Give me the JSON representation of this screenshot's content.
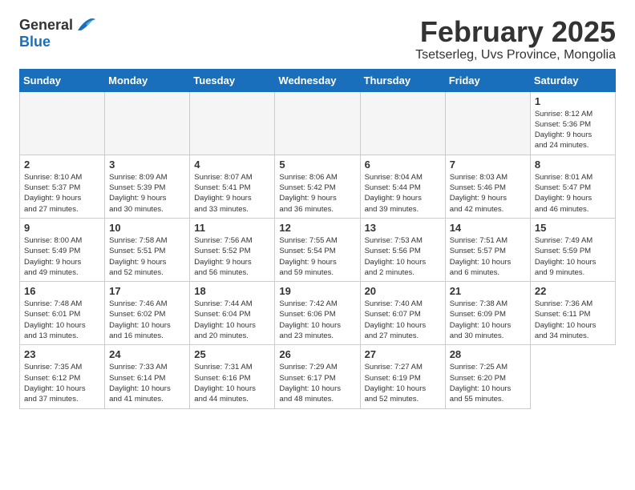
{
  "header": {
    "logo_general": "General",
    "logo_blue": "Blue",
    "month_title": "February 2025",
    "location": "Tsetserleg, Uvs Province, Mongolia"
  },
  "weekdays": [
    "Sunday",
    "Monday",
    "Tuesday",
    "Wednesday",
    "Thursday",
    "Friday",
    "Saturday"
  ],
  "days": [
    {
      "date": "",
      "info": ""
    },
    {
      "date": "",
      "info": ""
    },
    {
      "date": "",
      "info": ""
    },
    {
      "date": "",
      "info": ""
    },
    {
      "date": "",
      "info": ""
    },
    {
      "date": "",
      "info": ""
    },
    {
      "date": "1",
      "info": "Sunrise: 8:12 AM\nSunset: 5:36 PM\nDaylight: 9 hours\nand 24 minutes."
    },
    {
      "date": "2",
      "info": "Sunrise: 8:10 AM\nSunset: 5:37 PM\nDaylight: 9 hours\nand 27 minutes."
    },
    {
      "date": "3",
      "info": "Sunrise: 8:09 AM\nSunset: 5:39 PM\nDaylight: 9 hours\nand 30 minutes."
    },
    {
      "date": "4",
      "info": "Sunrise: 8:07 AM\nSunset: 5:41 PM\nDaylight: 9 hours\nand 33 minutes."
    },
    {
      "date": "5",
      "info": "Sunrise: 8:06 AM\nSunset: 5:42 PM\nDaylight: 9 hours\nand 36 minutes."
    },
    {
      "date": "6",
      "info": "Sunrise: 8:04 AM\nSunset: 5:44 PM\nDaylight: 9 hours\nand 39 minutes."
    },
    {
      "date": "7",
      "info": "Sunrise: 8:03 AM\nSunset: 5:46 PM\nDaylight: 9 hours\nand 42 minutes."
    },
    {
      "date": "8",
      "info": "Sunrise: 8:01 AM\nSunset: 5:47 PM\nDaylight: 9 hours\nand 46 minutes."
    },
    {
      "date": "9",
      "info": "Sunrise: 8:00 AM\nSunset: 5:49 PM\nDaylight: 9 hours\nand 49 minutes."
    },
    {
      "date": "10",
      "info": "Sunrise: 7:58 AM\nSunset: 5:51 PM\nDaylight: 9 hours\nand 52 minutes."
    },
    {
      "date": "11",
      "info": "Sunrise: 7:56 AM\nSunset: 5:52 PM\nDaylight: 9 hours\nand 56 minutes."
    },
    {
      "date": "12",
      "info": "Sunrise: 7:55 AM\nSunset: 5:54 PM\nDaylight: 9 hours\nand 59 minutes."
    },
    {
      "date": "13",
      "info": "Sunrise: 7:53 AM\nSunset: 5:56 PM\nDaylight: 10 hours\nand 2 minutes."
    },
    {
      "date": "14",
      "info": "Sunrise: 7:51 AM\nSunset: 5:57 PM\nDaylight: 10 hours\nand 6 minutes."
    },
    {
      "date": "15",
      "info": "Sunrise: 7:49 AM\nSunset: 5:59 PM\nDaylight: 10 hours\nand 9 minutes."
    },
    {
      "date": "16",
      "info": "Sunrise: 7:48 AM\nSunset: 6:01 PM\nDaylight: 10 hours\nand 13 minutes."
    },
    {
      "date": "17",
      "info": "Sunrise: 7:46 AM\nSunset: 6:02 PM\nDaylight: 10 hours\nand 16 minutes."
    },
    {
      "date": "18",
      "info": "Sunrise: 7:44 AM\nSunset: 6:04 PM\nDaylight: 10 hours\nand 20 minutes."
    },
    {
      "date": "19",
      "info": "Sunrise: 7:42 AM\nSunset: 6:06 PM\nDaylight: 10 hours\nand 23 minutes."
    },
    {
      "date": "20",
      "info": "Sunrise: 7:40 AM\nSunset: 6:07 PM\nDaylight: 10 hours\nand 27 minutes."
    },
    {
      "date": "21",
      "info": "Sunrise: 7:38 AM\nSunset: 6:09 PM\nDaylight: 10 hours\nand 30 minutes."
    },
    {
      "date": "22",
      "info": "Sunrise: 7:36 AM\nSunset: 6:11 PM\nDaylight: 10 hours\nand 34 minutes."
    },
    {
      "date": "23",
      "info": "Sunrise: 7:35 AM\nSunset: 6:12 PM\nDaylight: 10 hours\nand 37 minutes."
    },
    {
      "date": "24",
      "info": "Sunrise: 7:33 AM\nSunset: 6:14 PM\nDaylight: 10 hours\nand 41 minutes."
    },
    {
      "date": "25",
      "info": "Sunrise: 7:31 AM\nSunset: 6:16 PM\nDaylight: 10 hours\nand 44 minutes."
    },
    {
      "date": "26",
      "info": "Sunrise: 7:29 AM\nSunset: 6:17 PM\nDaylight: 10 hours\nand 48 minutes."
    },
    {
      "date": "27",
      "info": "Sunrise: 7:27 AM\nSunset: 6:19 PM\nDaylight: 10 hours\nand 52 minutes."
    },
    {
      "date": "28",
      "info": "Sunrise: 7:25 AM\nSunset: 6:20 PM\nDaylight: 10 hours\nand 55 minutes."
    }
  ]
}
